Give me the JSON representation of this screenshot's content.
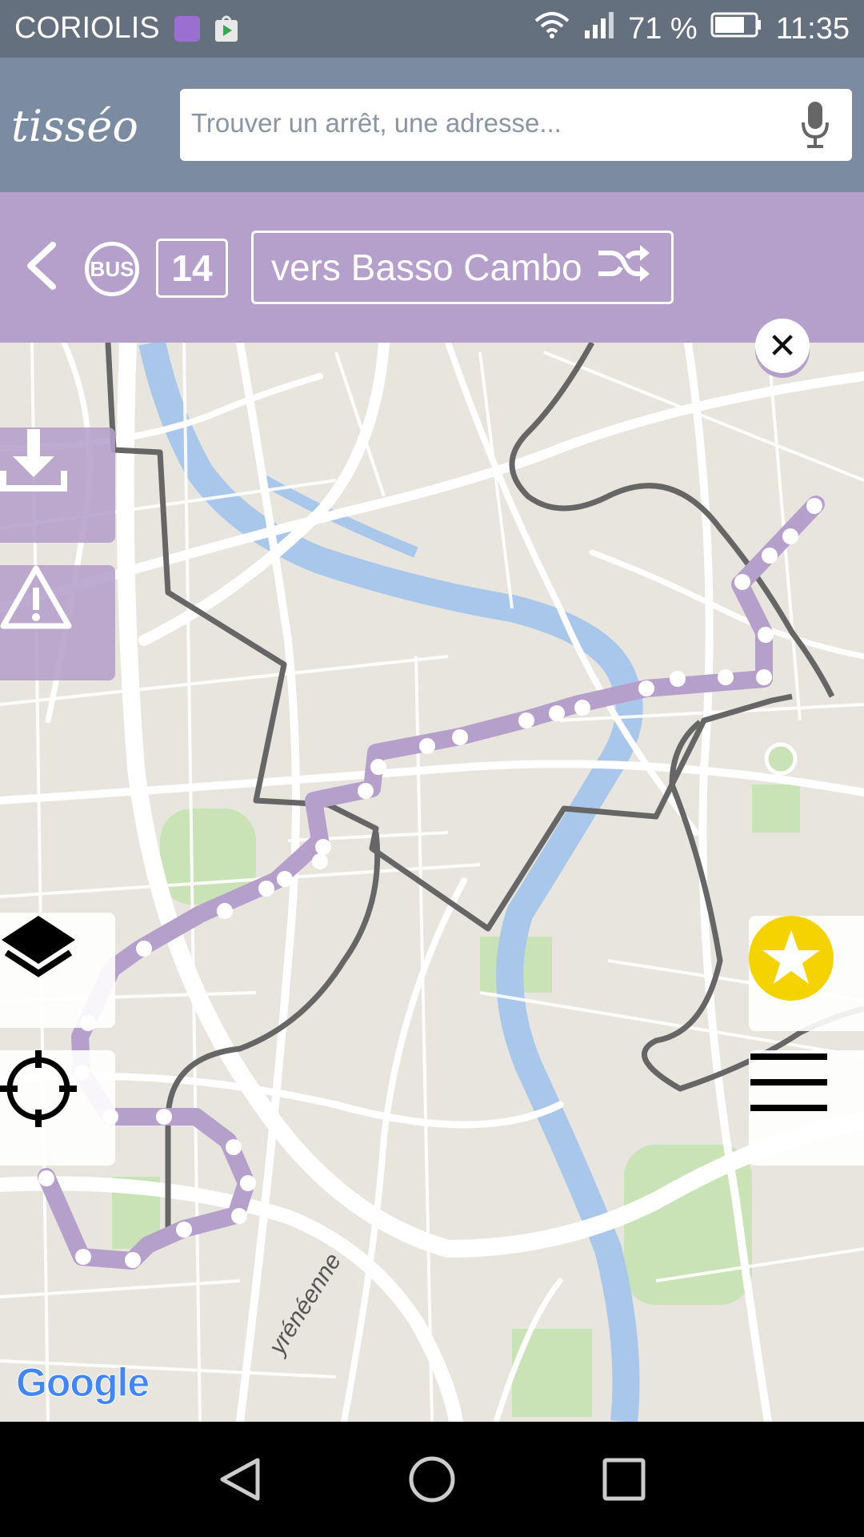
{
  "status_bar": {
    "carrier": "CORIOLIS",
    "battery_percent": "71 %",
    "time": "11:35",
    "icons": [
      "gallery-icon",
      "play-store-icon",
      "wifi-icon",
      "signal-icon",
      "battery-icon"
    ]
  },
  "app_header": {
    "logo_text": "tisséo",
    "search_placeholder": "Trouver un arrêt, une adresse..."
  },
  "line_header": {
    "mode": "BUS",
    "line_number": "14",
    "direction": "vers Basso Cambo"
  },
  "map": {
    "attribution": "Google",
    "street_label": "yrénéenne",
    "route_color": "#b59fcb"
  },
  "colors": {
    "status_bar": "#64707e",
    "app_bar": "#7b8ba2",
    "line_bar": "#b59fcb",
    "favorite": "#f5d300"
  }
}
